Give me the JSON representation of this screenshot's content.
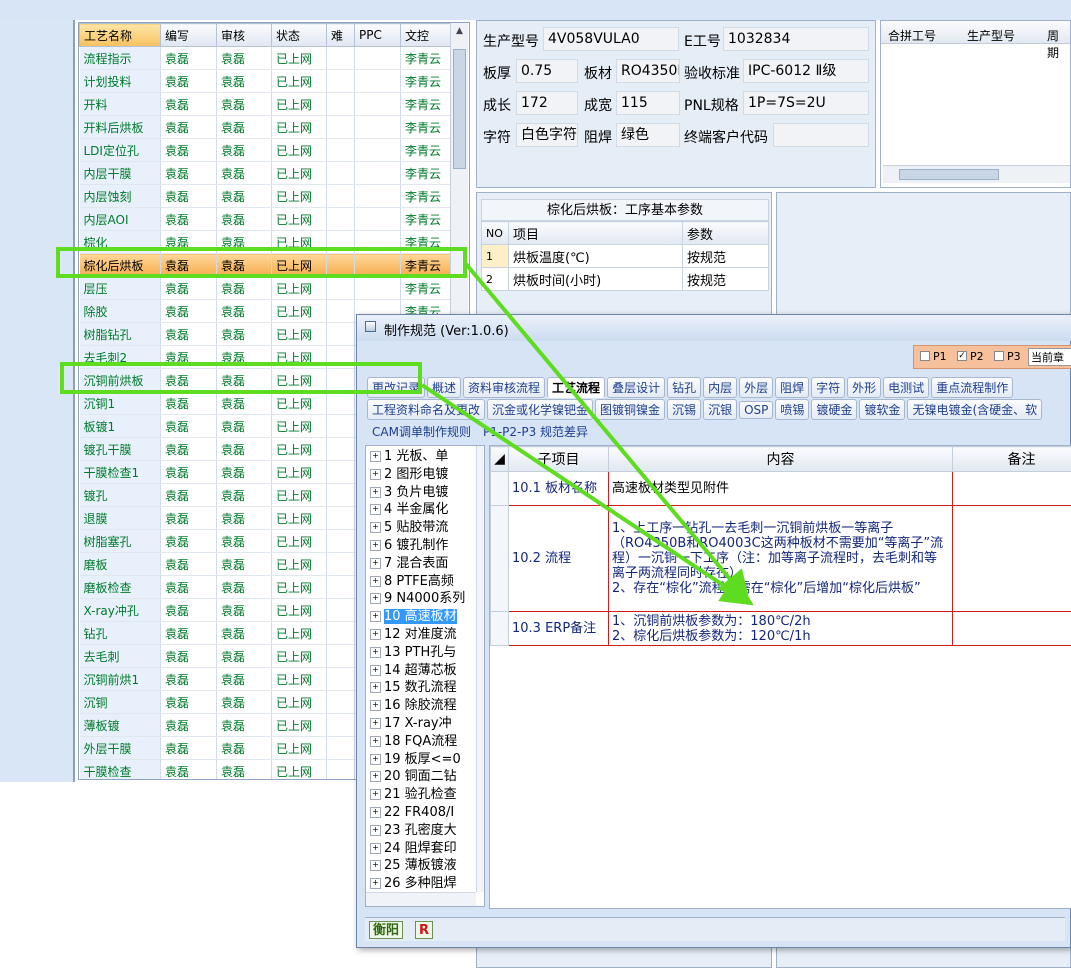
{
  "grid": {
    "columns": [
      "工艺名称",
      "编写",
      "审核",
      "状态",
      "难",
      "PPC",
      "文控"
    ],
    "rows": [
      [
        "流程指示",
        "袁磊",
        "袁磊",
        "已上网",
        "",
        "",
        "李青云"
      ],
      [
        "计划投料",
        "袁磊",
        "袁磊",
        "已上网",
        "",
        "",
        "李青云"
      ],
      [
        "开料",
        "袁磊",
        "袁磊",
        "已上网",
        "",
        "",
        "李青云"
      ],
      [
        "开料后烘板",
        "袁磊",
        "袁磊",
        "已上网",
        "",
        "",
        "李青云"
      ],
      [
        "LDI定位孔",
        "袁磊",
        "袁磊",
        "已上网",
        "",
        "",
        "李青云"
      ],
      [
        "内层干膜",
        "袁磊",
        "袁磊",
        "已上网",
        "",
        "",
        "李青云"
      ],
      [
        "内层蚀刻",
        "袁磊",
        "袁磊",
        "已上网",
        "",
        "",
        "李青云"
      ],
      [
        "内层AOI",
        "袁磊",
        "袁磊",
        "已上网",
        "",
        "",
        "李青云"
      ],
      [
        "棕化",
        "袁磊",
        "袁磊",
        "已上网",
        "",
        "",
        "李青云"
      ],
      [
        "棕化后烘板",
        "袁磊",
        "袁磊",
        "已上网",
        "",
        "",
        "李青云"
      ],
      [
        "层压",
        "袁磊",
        "袁磊",
        "已上网",
        "",
        "",
        "李青云"
      ],
      [
        "除胶",
        "袁磊",
        "袁磊",
        "已上网",
        "",
        "",
        "李青云"
      ],
      [
        "树脂钻孔",
        "袁磊",
        "袁磊",
        "已上网",
        "",
        "",
        ""
      ],
      [
        "去毛刺2",
        "袁磊",
        "袁磊",
        "已上网",
        "",
        "",
        ""
      ],
      [
        "沉铜前烘板",
        "袁磊",
        "袁磊",
        "已上网",
        "",
        "",
        ""
      ],
      [
        "沉铜1",
        "袁磊",
        "袁磊",
        "已上网",
        "",
        "",
        ""
      ],
      [
        "板镀1",
        "袁磊",
        "袁磊",
        "已上网",
        "",
        "",
        ""
      ],
      [
        "镀孔干膜",
        "袁磊",
        "袁磊",
        "已上网",
        "",
        "",
        ""
      ],
      [
        "干膜检查1",
        "袁磊",
        "袁磊",
        "已上网",
        "",
        "",
        ""
      ],
      [
        "镀孔",
        "袁磊",
        "袁磊",
        "已上网",
        "",
        "",
        ""
      ],
      [
        "退膜",
        "袁磊",
        "袁磊",
        "已上网",
        "",
        "",
        ""
      ],
      [
        "树脂塞孔",
        "袁磊",
        "袁磊",
        "已上网",
        "",
        "",
        ""
      ],
      [
        "磨板",
        "袁磊",
        "袁磊",
        "已上网",
        "",
        "",
        ""
      ],
      [
        "磨板检查",
        "袁磊",
        "袁磊",
        "已上网",
        "",
        "",
        ""
      ],
      [
        "X-ray冲孔",
        "袁磊",
        "袁磊",
        "已上网",
        "",
        "",
        ""
      ],
      [
        "钻孔",
        "袁磊",
        "袁磊",
        "已上网",
        "",
        "",
        ""
      ],
      [
        "去毛刺",
        "袁磊",
        "袁磊",
        "已上网",
        "",
        "",
        ""
      ],
      [
        "沉铜前烘1",
        "袁磊",
        "袁磊",
        "已上网",
        "",
        "",
        ""
      ],
      [
        "沉铜",
        "袁磊",
        "袁磊",
        "已上网",
        "",
        "",
        ""
      ],
      [
        "薄板镀",
        "袁磊",
        "袁磊",
        "已上网",
        "",
        "",
        ""
      ],
      [
        "外层干膜",
        "袁磊",
        "袁磊",
        "已上网",
        "",
        "",
        ""
      ],
      [
        "干膜检查",
        "袁磊",
        "袁磊",
        "已上网",
        "",
        "",
        ""
      ]
    ],
    "selected_row": 9
  },
  "info": {
    "prod_model_label": "生产型号",
    "prod_model": "4V058VULA0",
    "e_no_label": "E工号",
    "e_no": "1032834",
    "thickness_label": "板厚",
    "thickness": "0.75",
    "material_label": "板材",
    "material": "RO4350E",
    "accept_std_label": "验收标准",
    "accept_std": "IPC-6012 Ⅱ级",
    "length_label": "成长",
    "length": "172",
    "width_label": "成宽",
    "width": "115",
    "pnl_label": "PNL规格",
    "pnl": "1P=7S=2U",
    "char_label": "字符",
    "char": "白色字符",
    "mask_label": "阻焊",
    "mask": "绿色",
    "end_customer_label": "终端客户代码",
    "end_customer": ""
  },
  "merge": {
    "columns": [
      "合拼工号",
      "生产型号",
      "周期"
    ]
  },
  "params": {
    "title": "棕化后烘板：工序基本参数",
    "headers": [
      "NO",
      "项目",
      "参数"
    ],
    "rows": [
      [
        "1",
        "烘板温度(℃)",
        "按规范"
      ],
      [
        "2",
        "烘板时间(小时)",
        "按规范"
      ]
    ]
  },
  "dialog": {
    "title": "制作规范 (Ver:1.0.6)",
    "checks": {
      "p1": "P1",
      "p2": "P2",
      "p3": "P3",
      "current": "当前章"
    },
    "tabs_row1": [
      "更改记录",
      "概述",
      "资料审核流程",
      "工艺流程",
      "叠层设计",
      "钻孔",
      "内层",
      "外层",
      "阻焊",
      "字符",
      "外形",
      "电测试",
      "重点流程制作"
    ],
    "tabs_row2": [
      "工程资料命名及更改",
      "沉金或化学镍钯金",
      "图镀铜镍金",
      "沉锡",
      "沉银",
      "OSP",
      "喷锡",
      "镀硬金",
      "镀软金",
      "无镍电镀金(含硬金、软"
    ],
    "tabs_row3": [
      "CAM调单制作规则",
      "P1-P2-P3 规范差异"
    ],
    "active_tab": "工艺流程",
    "tree": [
      "1 光板、单",
      "2 图形电镀",
      "3 负片电镀",
      "4 半金属化",
      "5 贴胶带流",
      "6 镀孔制作",
      "7 混合表面",
      "8 PTFE高频",
      "9 N4000系列",
      "10 高速板材",
      "12 对准度流",
      "13 PTH孔与",
      "14 超薄芯板",
      "15 数孔流程",
      "16 除胶流程",
      "17 X-ray冲",
      "18 FQA流程",
      "19 板厚<=0",
      "20 铜面二钻",
      "21 验孔检查",
      "22 FR408/I",
      "23 孔密度大",
      "24 阻焊套印",
      "25 薄板镀液",
      "26 多种阻焊"
    ],
    "tree_selected": 9,
    "content_headers": [
      "子项目",
      "内容",
      "备注"
    ],
    "content_rows": [
      {
        "sub": "10.1 板材名称",
        "content": "高速板材类型见附件",
        "note": ""
      },
      {
        "sub": "10.2 流程",
        "content": "1、上工序一钻孔一去毛刺一沉铜前烘板一等离子（RO4350B和RO4003C这两种板材不需要加“等离子”流程）一沉铜一下工序（注：加等离子流程时，去毛刺和等离子两流程同时存在）\n2、存在“棕化”流程，需在“棕化”后增加“棕化后烘板”",
        "note": ""
      },
      {
        "sub": "10.3 ERP备注",
        "content": "1、沉铜前烘板参数为：180℃/2h\n2、棕化后烘板参数为：120℃/1h",
        "note": ""
      }
    ],
    "status": [
      "衡阳",
      "R"
    ]
  },
  "colors": {
    "highlight_box": "#5edc1f",
    "grid_text": "#007a2b",
    "selected_row": "#f5ac4d",
    "table_border_red": "#d41a1a"
  }
}
